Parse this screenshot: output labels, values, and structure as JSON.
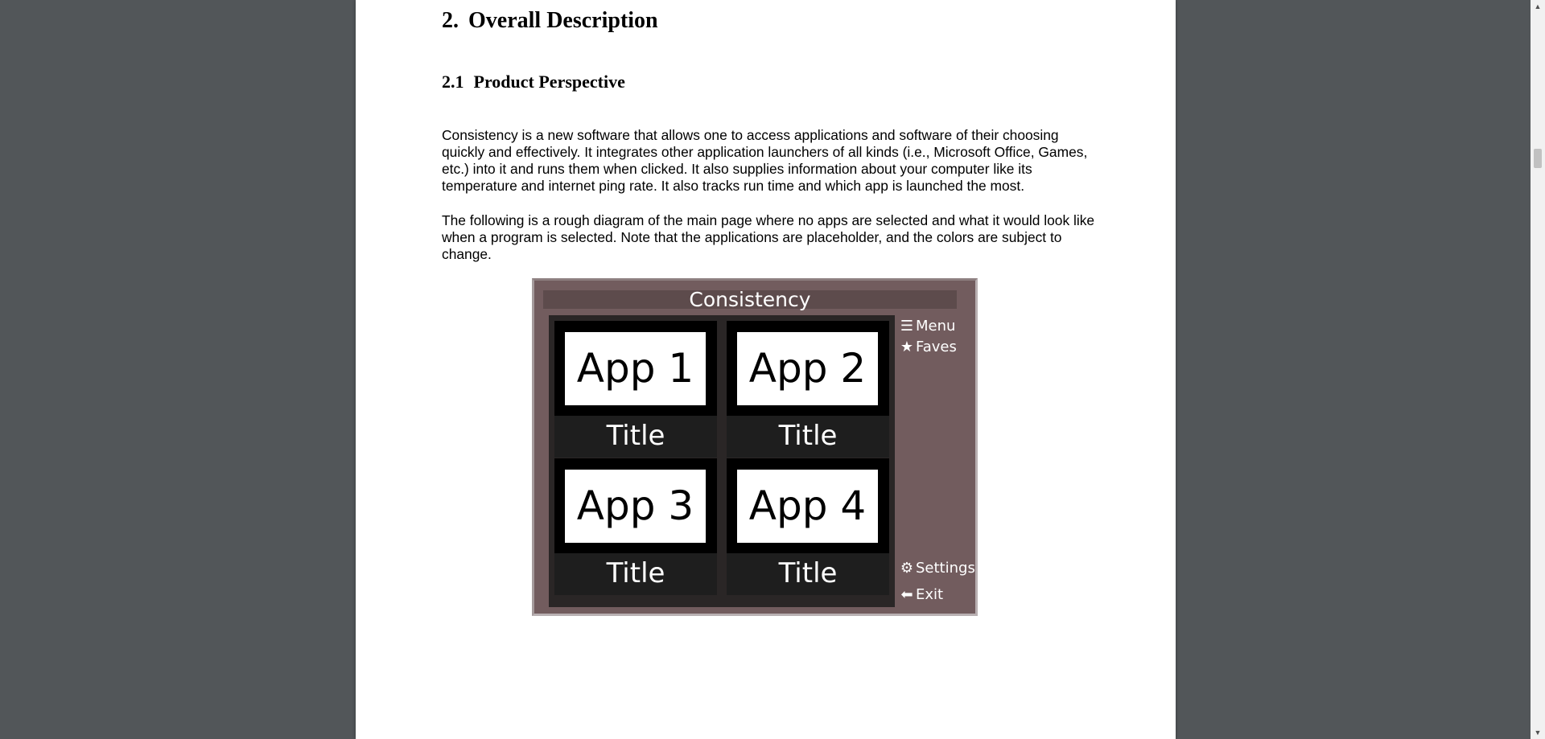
{
  "document": {
    "section": {
      "number": "2.",
      "title": "Overall Description"
    },
    "subsection": {
      "number": "2.1",
      "title": "Product Perspective"
    },
    "paragraph1": "Consistency is a new software that allows one to access applications and software of their choosing quickly and effectively. It integrates other application launchers of all kinds (i.e., Microsoft Office, Games, etc.) into it and runs them when clicked. It also supplies information about your computer like its temperature and internet ping rate. It also tracks run time and which app is launched the most.",
    "paragraph2": "The following is a rough diagram of the main page where no apps are selected and what it would look like when a program is selected. Note that the applications are placeholder, and the colors are subject to change."
  },
  "mockup": {
    "title": "Consistency",
    "tiles": [
      {
        "app": "App 1",
        "title": "Title"
      },
      {
        "app": "App 2",
        "title": "Title"
      },
      {
        "app": "App 3",
        "title": "Title"
      },
      {
        "app": "App 4",
        "title": "Title"
      }
    ],
    "sidebar": {
      "menu": {
        "icon": "menu-icon",
        "label": "Menu"
      },
      "faves": {
        "icon": "star-icon",
        "label": "Faves"
      },
      "settings": {
        "icon": "gear-icon",
        "label": "Settings"
      },
      "exit": {
        "icon": "arrow-left-icon",
        "label": "Exit"
      }
    },
    "colors": {
      "background": "#725c5e",
      "titlebar": "#5d4b4c",
      "grid": "#2a2626"
    }
  },
  "viewer": {
    "background": "#525659"
  }
}
